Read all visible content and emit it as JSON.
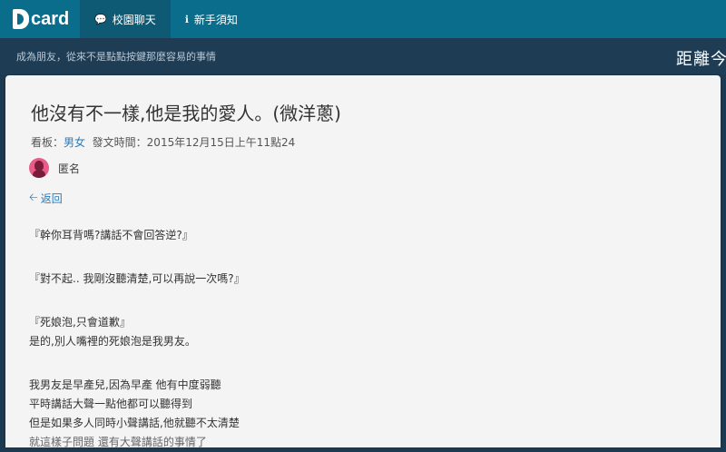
{
  "nav": {
    "logo_text": "card",
    "tabs": [
      {
        "label": "校園聊天",
        "icon": "chat-bubbles-icon",
        "active": true
      },
      {
        "label": "新手須知",
        "icon": "info-icon",
        "active": false
      }
    ]
  },
  "subheader": {
    "crumb": "成為朋友，從來不是點點按鍵那麼容易的事情",
    "right_text": "距離今"
  },
  "post": {
    "title": "他沒有不一樣,他是我的愛人。(微洋蔥)",
    "board_label": "看板：",
    "board_name": "男女",
    "time_label": "發文時間：2015年12月15日上午11點24",
    "author": "匿名",
    "back_label": "返回",
    "paragraphs": [
      [
        "『幹你耳背嗎?講話不會回答逆?』"
      ],
      [
        "『對不起.. 我剛沒聽清楚,可以再說一次嗎?』"
      ],
      [
        "『死娘泡,只會道歉』",
        "是的,別人嘴裡的死娘泡是我男友。"
      ],
      [
        "我男友是早產兒,因為早產 他有中度弱聽",
        "平時講話大聲一點他都可以聽得到",
        "但是如果多人同時小聲講話,他就聽不太清楚",
        "就這樣子問題 還有大聲講話的事情了"
      ]
    ]
  },
  "colors": {
    "topbar": "#0a6d8c",
    "subbar": "#1e3d55",
    "link": "#2b7ab8",
    "card": "#f4f4f4"
  }
}
